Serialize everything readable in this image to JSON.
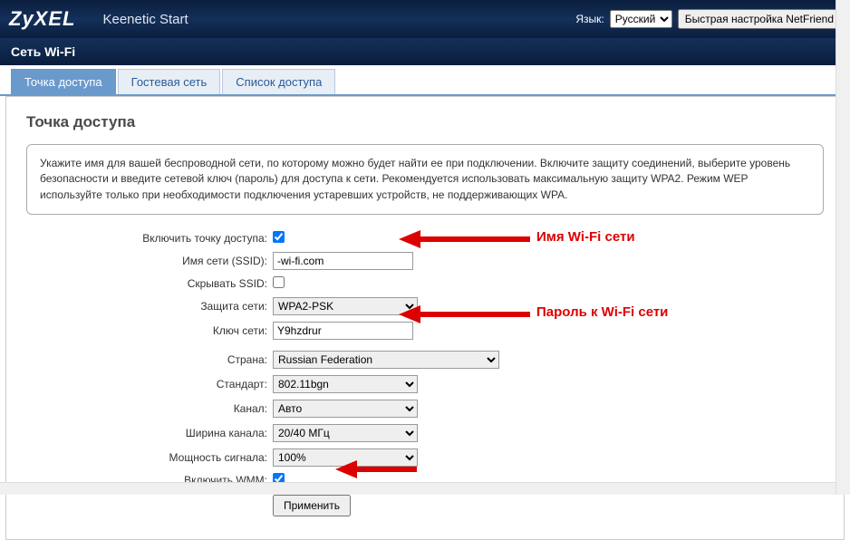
{
  "header": {
    "logo": "ZyXEL",
    "product": "Keenetic Start",
    "lang_label": "Язык:",
    "lang_value": "Русский",
    "netfriend_btn": "Быстрая настройка NetFriend"
  },
  "subheader": {
    "title": "Сеть Wi-Fi"
  },
  "tabs": [
    {
      "label": "Точка доступа",
      "active": true
    },
    {
      "label": "Гостевая сеть",
      "active": false
    },
    {
      "label": "Список доступа",
      "active": false
    }
  ],
  "page": {
    "title": "Точка доступа",
    "info": "Укажите имя для вашей беспроводной сети, по которому можно будет найти ее при подключении. Включите защиту соединений, выберите уровень безопасности и введите сетевой ключ (пароль) для доступа к сети. Рекомендуется использовать максимальную защиту WPA2. Режим WEP используйте только при необходимости подключения устаревших устройств, не поддерживающих WPA."
  },
  "form": {
    "enable_ap_label": "Включить точку доступа:",
    "enable_ap_checked": true,
    "ssid_label": "Имя сети (SSID):",
    "ssid_value": "-wi-fi.com",
    "hide_ssid_label": "Скрывать SSID:",
    "hide_ssid_checked": false,
    "security_label": "Защита сети:",
    "security_value": "WPA2-PSK",
    "key_label": "Ключ сети:",
    "key_value": "Y9hzdrur",
    "country_label": "Страна:",
    "country_value": "Russian Federation",
    "standard_label": "Стандарт:",
    "standard_value": "802.11bgn",
    "channel_label": "Канал:",
    "channel_value": "Авто",
    "width_label": "Ширина канала:",
    "width_value": "20/40 МГц",
    "power_label": "Мощность сигнала:",
    "power_value": "100%",
    "wmm_label": "Включить WMM:",
    "wmm_checked": true,
    "apply_btn": "Применить"
  },
  "annotations": {
    "ssid_note": "Имя Wi-Fi сети",
    "key_note": "Пароль к Wi-Fi сети"
  }
}
